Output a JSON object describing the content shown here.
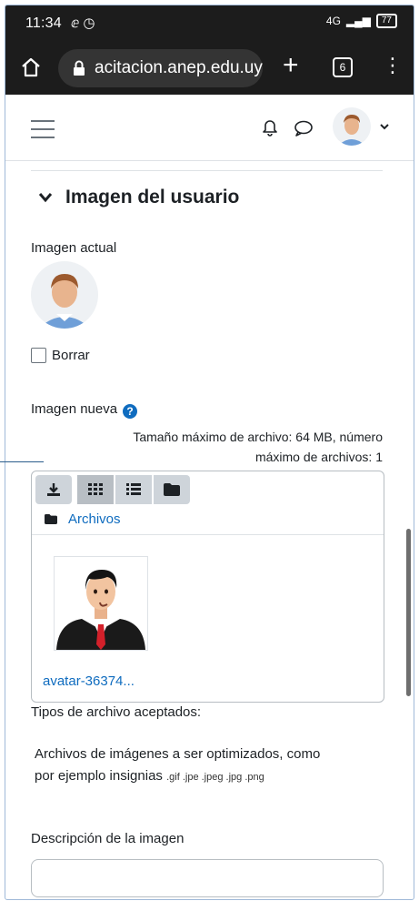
{
  "status_bar": {
    "time": "11:34",
    "signal": "4G",
    "battery": "77"
  },
  "browser": {
    "url": "acitacion.anep.edu.uy",
    "tab_count": "6"
  },
  "section": {
    "title": "Imagen del usuario"
  },
  "current_image": {
    "label": "Imagen actual",
    "delete_label": "Borrar"
  },
  "new_image": {
    "label": "Imagen nueva",
    "limit_line1": "Tamaño máximo de archivo: 64 MB, número",
    "limit_line2": "máximo de archivos: 1"
  },
  "file_picker": {
    "folder": "Archivos",
    "file_name": "avatar-36374..."
  },
  "accepted_types": {
    "label": "Tipos de archivo aceptados:",
    "desc_line1": "Archivos de imágenes a ser optimizados, como",
    "desc_line2": "por ejemplo insignias",
    "extensions": ".gif .jpe .jpeg .jpg .png"
  },
  "description": {
    "label": "Descripción de la imagen",
    "value": ""
  }
}
